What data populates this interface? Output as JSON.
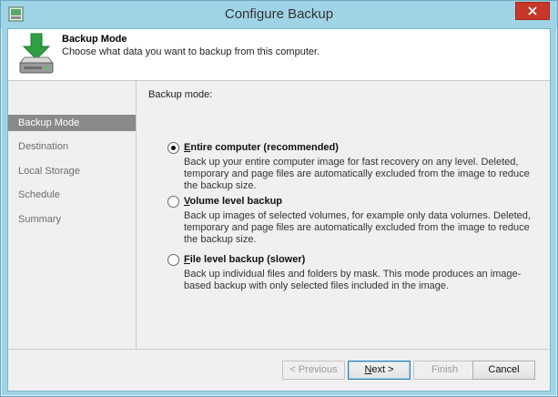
{
  "window": {
    "title": "Configure Backup"
  },
  "header": {
    "title": "Backup Mode",
    "subtitle": "Choose what data you want to backup from this computer."
  },
  "sidebar": {
    "items": [
      {
        "label": "Backup Mode",
        "active": true
      },
      {
        "label": "Destination",
        "active": false
      },
      {
        "label": "Local Storage",
        "active": false
      },
      {
        "label": "Schedule",
        "active": false
      },
      {
        "label": "Summary",
        "active": false
      }
    ]
  },
  "content": {
    "mode_label": "Backup mode:",
    "options": [
      {
        "title_u": "E",
        "title_rest": "ntire computer (recommended)",
        "selected": true,
        "description": "Back up your entire computer image for fast recovery on any level. Deleted, temporary and page files are automatically excluded from the image to reduce the backup size."
      },
      {
        "title_u": "V",
        "title_rest": "olume level backup",
        "selected": false,
        "description": "Back up images of selected volumes, for example only data volumes. Deleted, temporary and page files are automatically excluded from the image to reduce the backup size."
      },
      {
        "title_u": "F",
        "title_pre": "",
        "title_rest": "ile level backup (slower)",
        "selected": false,
        "description": "Back up individual files and folders by mask. This mode produces an image-based backup with only selected files included in the image."
      }
    ]
  },
  "footer": {
    "previous": "< Previous",
    "next_u": "N",
    "next_rest": "ext >",
    "finish": "Finish",
    "cancel": "Cancel"
  },
  "colors": {
    "titlebar": "#9fd4e6",
    "close_button": "#c7372a",
    "sidebar_active": "#8a8a8a",
    "icon_green": "#2ea043"
  },
  "icons": [
    "app-icon",
    "close-icon",
    "backup-drive-icon"
  ]
}
